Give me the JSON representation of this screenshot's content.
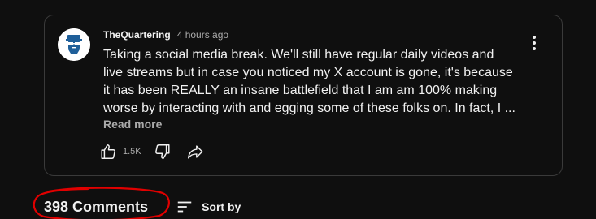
{
  "post": {
    "author": "TheQuartering",
    "time": "4 hours ago",
    "text": "Taking a social media break.  We'll still have regular daily videos and live streams but in case you noticed my X account is gone, it's because it has been REALLY an insane battlefield that I am am 100% making worse by interacting with and egging some of these folks on. In fact, I ...",
    "read_more": "Read more",
    "like_count": "1.5K",
    "icons": {
      "avatar": "avatar-glasses-icon",
      "menu": "more-vert-icon",
      "like": "thumb-up-icon",
      "dislike": "thumb-down-icon",
      "share": "share-icon"
    }
  },
  "comments": {
    "count_label": "398 Comments",
    "sort_label": "Sort by",
    "sort_icon": "sort-icon"
  },
  "colors": {
    "background": "#0f0f0f",
    "card_border": "#3a3a3a",
    "text_primary": "#f1f1f1",
    "text_secondary": "#aaaaaa",
    "annotation_red": "#e10000",
    "avatar_blue": "#1f5f9a"
  }
}
